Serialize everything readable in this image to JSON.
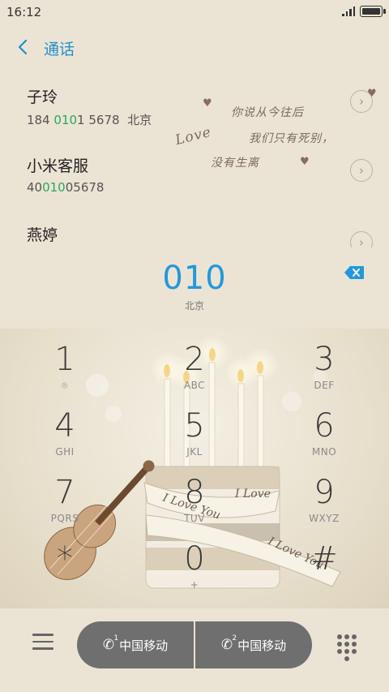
{
  "status": {
    "time": "16:12",
    "battery_percent": 100
  },
  "header": {
    "title": "通话"
  },
  "contacts": [
    {
      "name": "子玲",
      "number_prefix": "184 ",
      "number_match": "010",
      "number_suffix": "1 5678",
      "location": "北京"
    },
    {
      "name": "小米客服",
      "number_prefix": "40",
      "number_match": "010",
      "number_suffix": "05678",
      "location": ""
    },
    {
      "name": "燕婷",
      "number_prefix": "",
      "number_match": "",
      "number_suffix": "",
      "location": ""
    }
  ],
  "handwriting": {
    "line1": "你说从今往后",
    "word": "Love",
    "line2": "我们只有死别，",
    "line3": "没有生离"
  },
  "dial": {
    "number": "010",
    "location": "北京"
  },
  "keys": [
    {
      "digit": "1",
      "letters": "⌾"
    },
    {
      "digit": "2",
      "letters": "ABC"
    },
    {
      "digit": "3",
      "letters": "DEF"
    },
    {
      "digit": "4",
      "letters": "GHI"
    },
    {
      "digit": "5",
      "letters": "JKL"
    },
    {
      "digit": "6",
      "letters": "MNO"
    },
    {
      "digit": "7",
      "letters": "PQRS"
    },
    {
      "digit": "8",
      "letters": "TUV"
    },
    {
      "digit": "9",
      "letters": "WXYZ"
    },
    {
      "digit": "*",
      "letters": ""
    },
    {
      "digit": "0",
      "letters": "+"
    },
    {
      "digit": "#",
      "letters": ""
    }
  ],
  "calls": {
    "sim1_label": "中国移动",
    "sim2_label": "中国移动",
    "sim2_index": "2"
  },
  "colors": {
    "accent": "#2398dc",
    "match": "#2aa85f",
    "call_button": "#6f6f6f"
  },
  "icons": [
    "back-icon",
    "backspace-icon",
    "menu-icon",
    "dialpad-icon",
    "phone-icon"
  ]
}
